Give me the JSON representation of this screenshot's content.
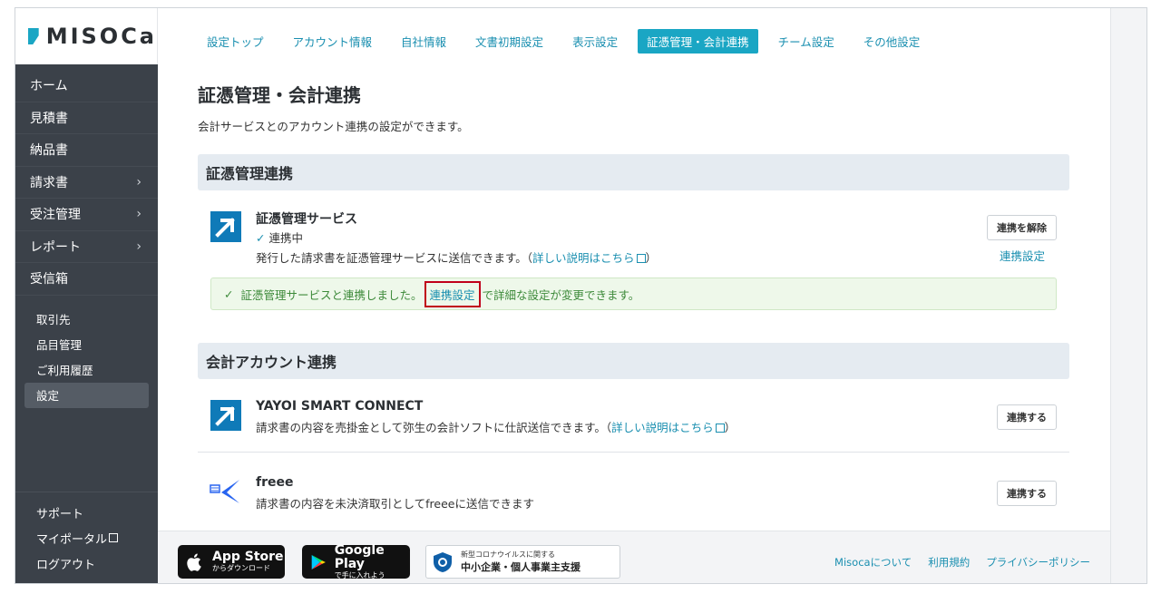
{
  "app": {
    "logo_text": "MISOCa"
  },
  "sidebar": {
    "main_items": [
      {
        "label": "ホーム",
        "has_submenu": false
      },
      {
        "label": "見積書",
        "has_submenu": false
      },
      {
        "label": "納品書",
        "has_submenu": false
      },
      {
        "label": "請求書",
        "has_submenu": true
      },
      {
        "label": "受注管理",
        "has_submenu": true
      },
      {
        "label": "レポート",
        "has_submenu": true
      },
      {
        "label": "受信箱",
        "has_submenu": false
      }
    ],
    "sub_items": [
      {
        "label": "取引先"
      },
      {
        "label": "品目管理"
      },
      {
        "label": "ご利用履歴"
      },
      {
        "label": "設定",
        "active": true
      }
    ],
    "bottom_items": [
      {
        "label": "サポート"
      },
      {
        "label": "マイポータル"
      },
      {
        "label": "ログアウト"
      }
    ],
    "chevron": "›"
  },
  "tabs": [
    {
      "label": "設定トップ"
    },
    {
      "label": "アカウント情報"
    },
    {
      "label": "自社情報"
    },
    {
      "label": "文書初期設定"
    },
    {
      "label": "表示設定"
    },
    {
      "label": "証憑管理・会計連携",
      "active": true
    },
    {
      "label": "チーム設定"
    },
    {
      "label": "その他設定"
    }
  ],
  "page": {
    "title": "証憑管理・会計連携",
    "description": "会計サービスとのアカウント連携の設定ができます。"
  },
  "voucher_section": {
    "header": "証憑管理連携",
    "service": {
      "name": "証憑管理サービス",
      "status_check": "✓",
      "status": "連携中",
      "desc_prefix": "発行した請求書を証憑管理サービスに送信できます。（",
      "desc_link": "詳しい説明はこちら",
      "desc_suffix": "）",
      "unlink_button": "連携を解除",
      "settings_link": "連携設定"
    },
    "notice": {
      "check": "✓",
      "prefix": "証憑管理サービスと連携しました。",
      "link": "連携設定",
      "suffix": "で詳細な設定が変更できます。"
    }
  },
  "accounting_section": {
    "header": "会計アカウント連携",
    "services": [
      {
        "name": "YAYOI SMART CONNECT",
        "desc_prefix": "請求書の内容を売掛金として弥生の会計ソフトに仕訳送信できます。（",
        "desc_link": "詳しい説明はこちら",
        "desc_suffix": "）",
        "button": "連携する"
      },
      {
        "name": "freee",
        "desc_prefix": "請求書の内容を未決済取引としてfreeeに送信できます",
        "button": "連携する"
      }
    ]
  },
  "footer": {
    "app_store": {
      "line1": "App Store",
      "line2": "からダウンロード"
    },
    "google_play": {
      "line1": "Google Play",
      "line2": "で手に入れよう"
    },
    "covid": {
      "line1": "新型コロナウイルスに関する",
      "line2": "中小企業・個人事業主支援"
    },
    "links": [
      "Misocaについて",
      "利用規約",
      "プライバシーポリシー"
    ]
  },
  "colors": {
    "accent": "#1aa6c4",
    "sidebar_bg": "#3b4149",
    "highlight_box": "#c0001a",
    "notice_bg": "#eef8ea"
  }
}
